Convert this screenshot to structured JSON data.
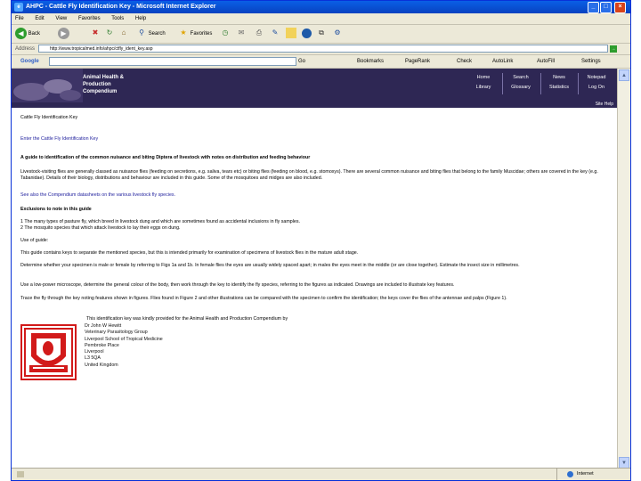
{
  "window": {
    "title": "AHPC - Cattle Fly Identification Key - Microsoft Internet Explorer",
    "controls": [
      "_",
      "□",
      "×"
    ]
  },
  "menu": [
    "File",
    "Edit",
    "View",
    "Favorites",
    "Tools",
    "Help"
  ],
  "toolbar": {
    "back": "Back",
    "search": "Search",
    "favorites": "Favorites"
  },
  "address": {
    "label": "Address",
    "url": "http://www.tropicalmed.info/ahpc/ctfly_ident_key.asp",
    "go": "Go"
  },
  "google": {
    "logo": "Google",
    "search_label": "Search",
    "items": [
      "Go",
      "Bookmarks",
      "PageRank",
      "Check",
      "AutoLink",
      "AutoFill"
    ],
    "settings": "Settings"
  },
  "site": {
    "name_lines": [
      "Animal Health &",
      "Production",
      "Compendium"
    ],
    "nav": [
      "Home",
      "Search",
      "News",
      "Notepad",
      "Library",
      "Glossary",
      "Statistics",
      "Log On"
    ],
    "about": "Site Help"
  },
  "page": {
    "heading": "Cattle Fly Identification Key",
    "enter": "Enter the Cattle Fly Identification Key",
    "guide_title": "A guide to identification of the common nuisance and biting Diptera of livestock with notes on distribution and feeding behaviour",
    "intro": "Livestock-visiting flies are generally classed as nuisance flies (feeding on secretions, e.g. saliva, tears etc) or biting flies (feeding on blood, e.g. stomoxys). There are several common nuisance and biting flies that belong to the family Muscidae; others are covered in the key (e.g. Tabanidae). Details of their biology, distributions and behaviour are included in this guide. Some of the mosquitoes and midges are also included.",
    "see_also": "See also the Compendium datasheets on the various livestock fly species.",
    "exclusions_title": "Exclusions to note in this guide",
    "exclusions": [
      "1  The many types of pasture fly, which breed in livestock dung and which are sometimes found as accidental inclusions in fly samples.",
      "2  The mosquito species that which attack livestock to lay their eggs on dung."
    ],
    "use_title": "Use of guide:",
    "use_text": "This guide contains keys to separate the mentioned species, but this is intended primarily for examination of specimens of livestock flies in the mature adult stage.",
    "determine": "Determine whether your specimen is male or female by referring to Figs 1a and 1b. In female flies the eyes are usually widely spaced apart; in males the eyes meet in the middle (or are close together). Estimate the insect size in millimetres.",
    "use_key": "Use a low-power microscope, determine the general colour of the body, then work through the key to identify the fly species, referring to the figures as indicated. Drawings are included to illustrate key features.",
    "trace": "Trace the fly through the key noting features shown in figures. Flies found in Figure 2 and other illustrations can be compared with the specimen to confirm the identification; the keys cover the flies of the antennae and palps (Figure 1).",
    "sponsor": "This identification key was kindly provided for the Animal Health and Production Compendium by",
    "address_lines": [
      "Dr John W Hewitt",
      "Veterinary Parasitology Group",
      "Liverpool School of Tropical Medicine",
      "Pembroke Place",
      "Liverpool",
      "L3 5QA",
      "United Kingdom"
    ]
  },
  "status": {
    "zone": "Internet"
  },
  "colors": {
    "titlebar": "#0a5fe6",
    "banner": "#2e2754",
    "link": "#22229e",
    "logo_red": "#d21a1a"
  }
}
